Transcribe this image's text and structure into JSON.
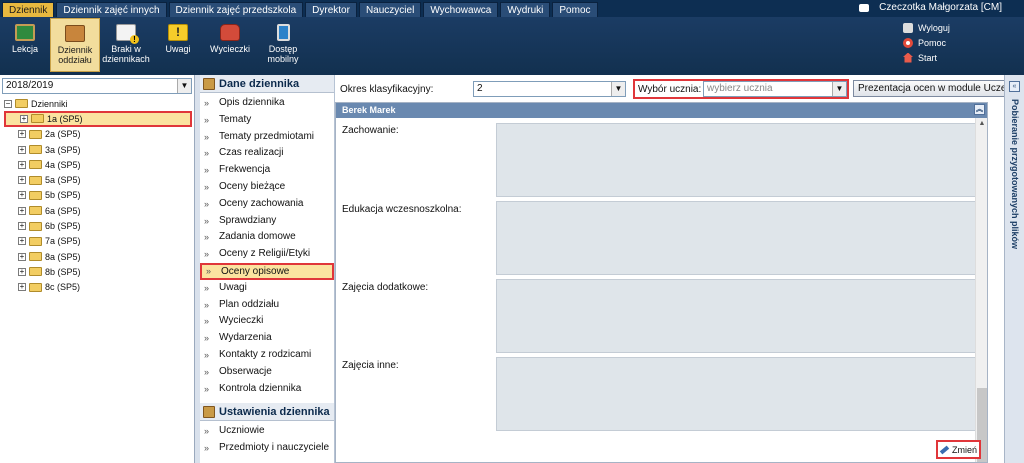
{
  "menu": {
    "tabs": [
      {
        "label": "Dziennik",
        "active": true
      },
      {
        "label": "Dziennik zajęć innych",
        "active": false
      },
      {
        "label": "Dziennik zajęć przedszkola",
        "active": false
      },
      {
        "label": "Dyrektor",
        "active": false
      },
      {
        "label": "Nauczyciel",
        "active": false
      },
      {
        "label": "Wychowawca",
        "active": false
      },
      {
        "label": "Wydruki",
        "active": false
      },
      {
        "label": "Pomoc",
        "active": false
      }
    ]
  },
  "user": {
    "name": "Czeczotka Małgorzata [CM]"
  },
  "ribbon": {
    "buttons": [
      {
        "label": "Lekcja",
        "icon": "chalkboard-icon"
      },
      {
        "label": "Dziennik oddziału",
        "icon": "book-icon",
        "active": true
      },
      {
        "label": "Braki w dziennikach",
        "icon": "missing-icon"
      },
      {
        "label": "Uwagi",
        "icon": "warning-icon"
      },
      {
        "label": "Wycieczki",
        "icon": "backpack-icon"
      },
      {
        "label": "Dostęp mobilny",
        "icon": "phone-icon"
      }
    ],
    "side_links": [
      {
        "label": "Wyloguj",
        "icon": "lock-icon"
      },
      {
        "label": "Pomoc",
        "icon": "lifebuoy-icon"
      },
      {
        "label": "Start",
        "icon": "home-icon"
      }
    ]
  },
  "left": {
    "year": "2018/2019",
    "root": "Dzienniki",
    "classes": [
      "1a (SP5)",
      "2a (SP5)",
      "3a (SP5)",
      "4a (SP5)",
      "5a (SP5)",
      "5b (SP5)",
      "6a (SP5)",
      "6b (SP5)",
      "7a (SP5)",
      "8a (SP5)",
      "8b (SP5)",
      "8c (SP5)"
    ],
    "selected": "1a (SP5)"
  },
  "nav": {
    "section1": "Dane dziennika",
    "items": [
      "Opis dziennika",
      "Tematy",
      "Tematy przedmiotami",
      "Czas realizacji",
      "Frekwencja",
      "Oceny bieżące",
      "Oceny zachowania",
      "Sprawdziany",
      "Zadania domowe",
      "Oceny z Religii/Etyki",
      "Oceny opisowe",
      "Uwagi",
      "Plan oddziału",
      "Wycieczki",
      "Wydarzenia",
      "Kontakty z rodzicami",
      "Obserwacje",
      "Kontrola dziennika"
    ],
    "selected": "Oceny opisowe",
    "section2": "Ustawienia dziennika",
    "items2": [
      "Uczniowie",
      "Przedmioty i nauczyciele"
    ]
  },
  "filters": {
    "period_label": "Okres klasyfikacyjny:",
    "period_value": "2",
    "student_label": "Wybór ucznia:",
    "student_placeholder": "wybierz ucznia",
    "present_button": "Prezentacja ocen w module Uczeń"
  },
  "panel": {
    "student_name": "Berek Marek",
    "fields": [
      "Zachowanie:",
      "Edukacja wczesnoszkolna:",
      "Zajęcia dodatkowe:",
      "Zajęcia inne:"
    ],
    "change_button": "Zmień"
  },
  "right_strip": {
    "label": "Pobieranie przygotowanych plików"
  },
  "colors": {
    "menu_bg": "#0d2e52",
    "active_tab": "#e7b83f",
    "highlight": "#fbe3a0",
    "red_outline": "#e0363a",
    "panel_header": "#6a89b0"
  }
}
